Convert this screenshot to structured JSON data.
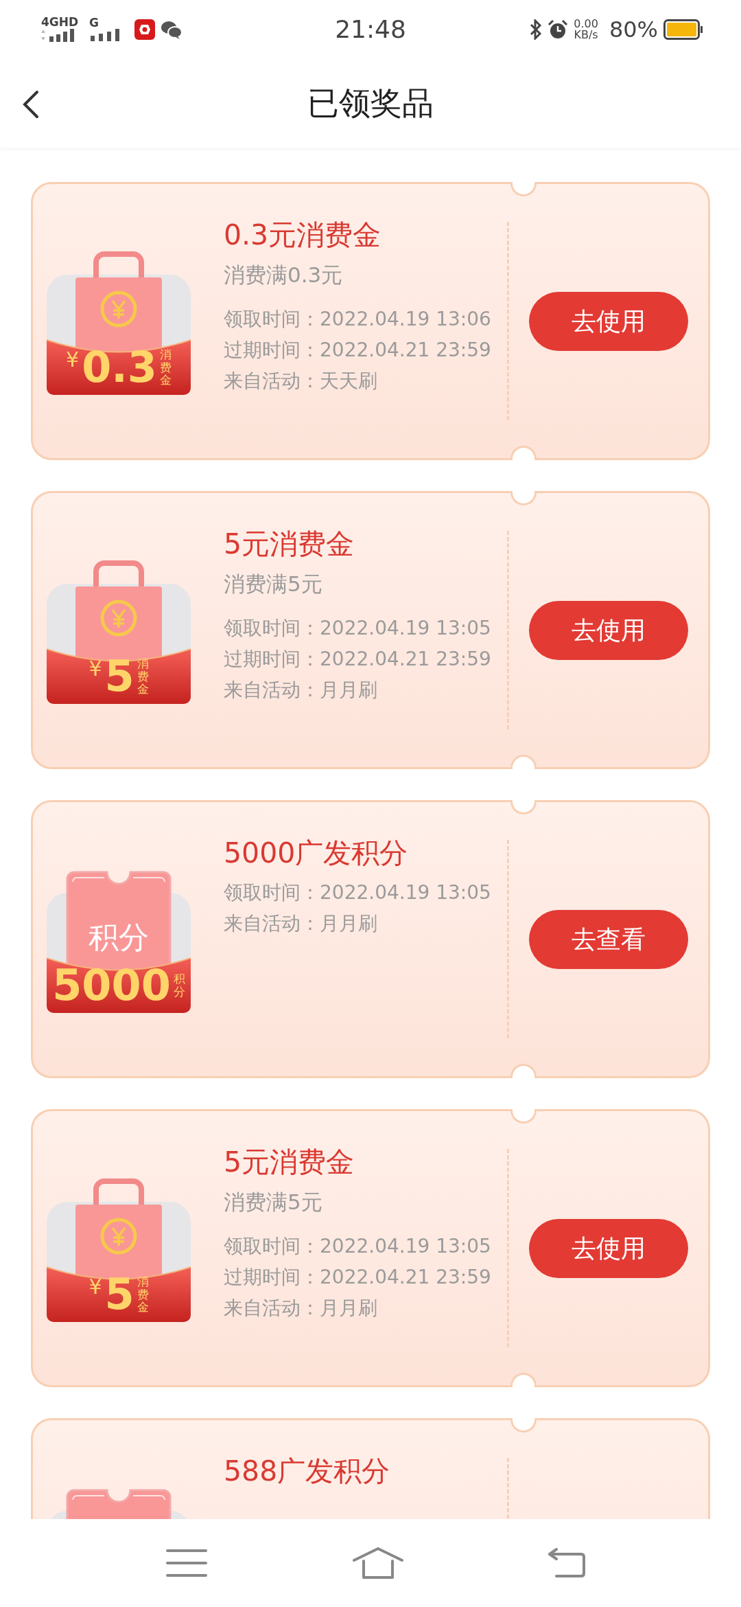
{
  "status_bar": {
    "network_1": "4GHD",
    "network_2": "G",
    "time": "21:48",
    "speed": "0.00",
    "speed_unit": "KB/s",
    "battery": "80%"
  },
  "header": {
    "title": "已领奖品"
  },
  "prizes": [
    {
      "kind": "voucher",
      "icon": {
        "currency": "¥",
        "amount": "0.3",
        "unit": "消费金"
      },
      "title": "0.3元消费金",
      "condition": "消费满0.3元",
      "details": [
        "领取时间：2022.04.19 13:06",
        "过期时间：2022.04.21 23:59",
        "来自活动：天天刷"
      ],
      "button": "去使用"
    },
    {
      "kind": "voucher",
      "icon": {
        "currency": "¥",
        "amount": "5",
        "unit": "消费金"
      },
      "title": "5元消费金",
      "condition": "消费满5元",
      "details": [
        "领取时间：2022.04.19 13:05",
        "过期时间：2022.04.21 23:59",
        "来自活动：月月刷"
      ],
      "button": "去使用"
    },
    {
      "kind": "points",
      "icon": {
        "label": "积分",
        "amount": "5000",
        "unit": "积分"
      },
      "title": "5000广发积分",
      "details": [
        "领取时间：2022.04.19 13:05",
        "来自活动：月月刷"
      ],
      "button": "去查看"
    },
    {
      "kind": "voucher",
      "icon": {
        "currency": "¥",
        "amount": "5",
        "unit": "消费金"
      },
      "title": "5元消费金",
      "condition": "消费满5元",
      "details": [
        "领取时间：2022.04.19 13:05",
        "过期时间：2022.04.21 23:59",
        "来自活动：月月刷"
      ],
      "button": "去使用"
    },
    {
      "kind": "points",
      "title": "588广发积分"
    }
  ]
}
